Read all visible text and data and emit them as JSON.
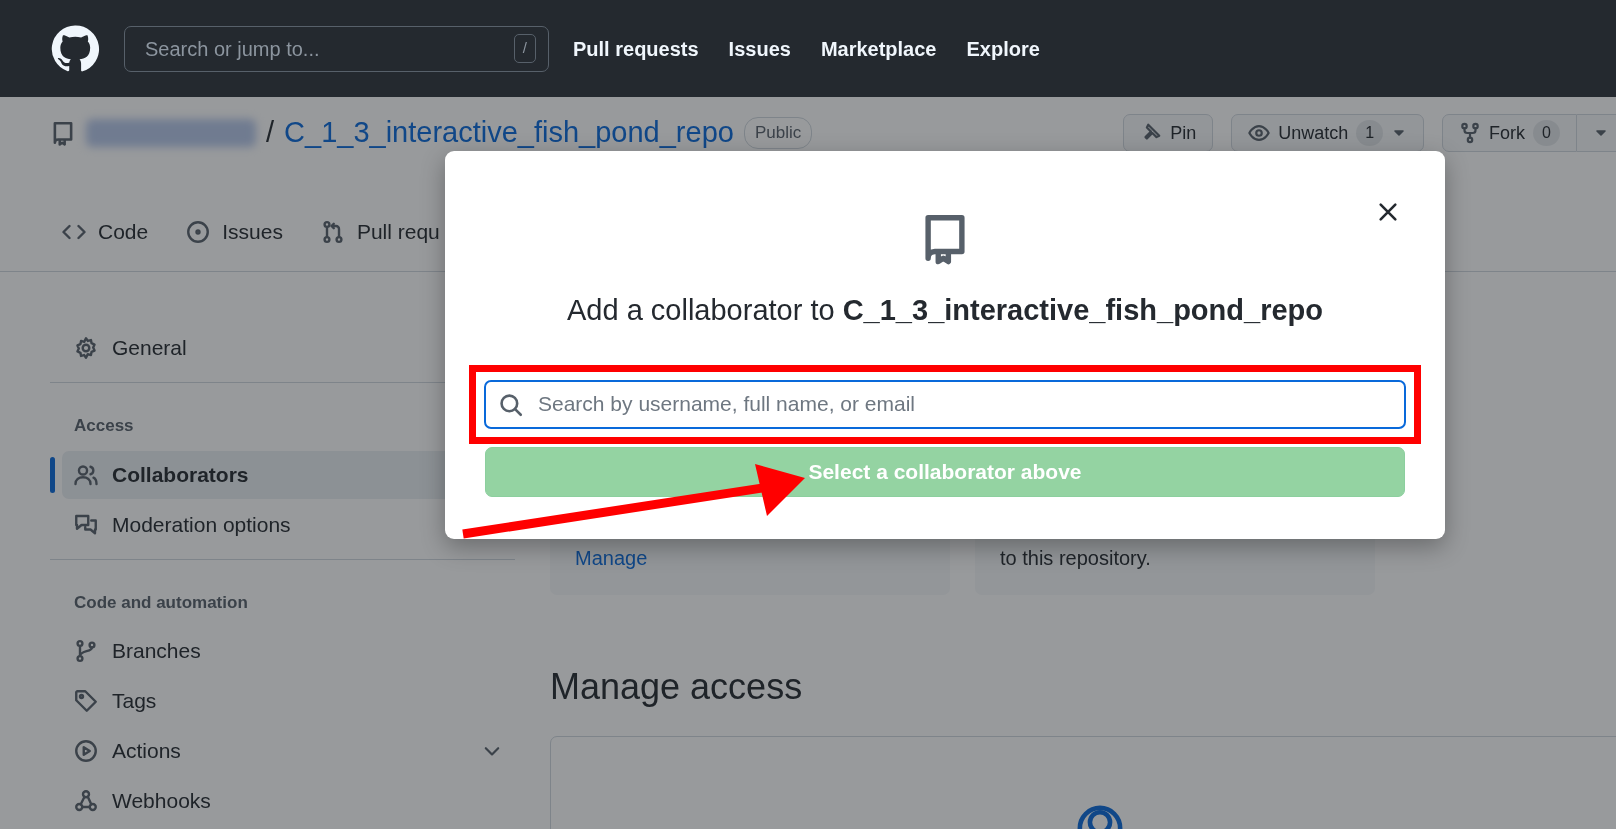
{
  "header": {
    "search_placeholder": "Search or jump to...",
    "search_key": "/",
    "nav": [
      "Pull requests",
      "Issues",
      "Marketplace",
      "Explore"
    ]
  },
  "repo": {
    "separator": "/",
    "name": "C_1_3_interactive_fish_pond_repo",
    "visibility": "Public",
    "actions": [
      {
        "kind": "pin",
        "label": "Pin"
      },
      {
        "kind": "watch",
        "label": "Unwatch",
        "count": "1",
        "dropdown": true
      },
      {
        "kind": "fork",
        "label": "Fork",
        "count": "0",
        "split": true
      }
    ]
  },
  "tabs": [
    {
      "kind": "code",
      "label": "Code",
      "selected": false
    },
    {
      "kind": "issues",
      "label": "Issues",
      "selected": false
    },
    {
      "kind": "pulls",
      "label": "Pull requ",
      "selected": false
    }
  ],
  "sidebar": [
    {
      "kind": "item",
      "label": "General",
      "selected": false
    },
    {
      "kind": "divider"
    },
    {
      "kind": "heading",
      "label": "Access"
    },
    {
      "kind": "item",
      "label": "Collaborators",
      "selected": true
    },
    {
      "kind": "item",
      "label": "Moderation options",
      "selected": false
    },
    {
      "kind": "divider"
    },
    {
      "kind": "heading",
      "label": "Code and automation"
    },
    {
      "kind": "item",
      "label": "Branches",
      "selected": false
    },
    {
      "kind": "item",
      "label": "Tags",
      "selected": false
    },
    {
      "kind": "item",
      "label": "Actions",
      "selected": false,
      "expanded": false
    },
    {
      "kind": "item",
      "label": "Webhooks",
      "selected": false
    }
  ],
  "cards": [
    {
      "link": "Manage"
    },
    {
      "text": "to this repository."
    }
  ],
  "manage_access": {
    "title": "Manage access"
  },
  "modal": {
    "title": "Add a collaborator to **C_1_3_interactive_fish_pond_repo**",
    "search_placeholder": "Search by username, full name, or email",
    "button": {
      "label": "Select a collaborator above",
      "disabled": true
    }
  },
  "annotations": {
    "highlight_box": true,
    "arrow": true
  }
}
